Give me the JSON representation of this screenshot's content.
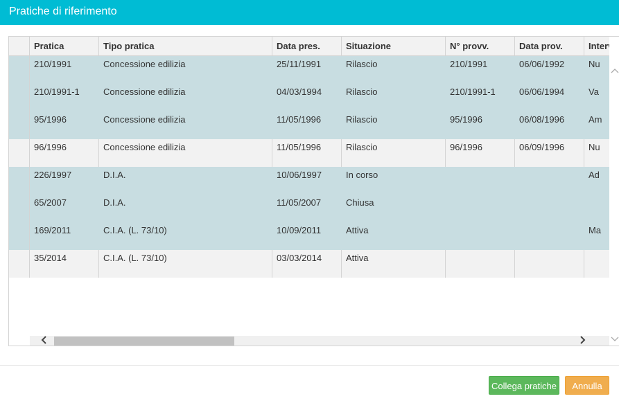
{
  "dialog": {
    "title": "Pratiche di riferimento"
  },
  "table": {
    "columns": [
      "Pratica",
      "Tipo pratica",
      "Data pres.",
      "Situazione",
      "N° provv.",
      "Data prov.",
      "Interv"
    ],
    "rows": [
      {
        "cells": [
          "210/1991",
          "Concessione edilizia",
          "25/11/1991",
          "Rilascio",
          "210/1991",
          "06/06/1992",
          "Nu"
        ],
        "selected": true
      },
      {
        "cells": [
          "210/1991-1",
          "Concessione edilizia",
          "04/03/1994",
          "Rilascio",
          "210/1991-1",
          "06/06/1994",
          "Va"
        ],
        "selected": true
      },
      {
        "cells": [
          "95/1996",
          "Concessione edilizia",
          "11/05/1996",
          "Rilascio",
          "95/1996",
          "06/08/1996",
          "Am"
        ],
        "selected": true
      },
      {
        "cells": [
          "96/1996",
          "Concessione edilizia",
          "11/05/1996",
          "Rilascio",
          "96/1996",
          "06/09/1996",
          "Nu"
        ],
        "selected": false
      },
      {
        "cells": [
          "226/1997",
          "D.I.A.",
          "10/06/1997",
          "In corso",
          "",
          "",
          "Ad"
        ],
        "selected": true
      },
      {
        "cells": [
          "65/2007",
          "D.I.A.",
          "11/05/2007",
          "Chiusa",
          "",
          "",
          ""
        ],
        "selected": true
      },
      {
        "cells": [
          "169/2011",
          "C.I.A. (L. 73/10)",
          "10/09/2011",
          "Attiva",
          "",
          "",
          "Ma"
        ],
        "selected": true
      },
      {
        "cells": [
          "35/2014",
          "C.I.A. (L. 73/10)",
          "03/03/2014",
          "Attiva",
          "",
          "",
          ""
        ],
        "selected": false
      }
    ]
  },
  "icons": {
    "scroll_up": "chevron-up-icon",
    "scroll_down": "chevron-down-icon",
    "scroll_left": "chevron-left-icon",
    "scroll_right": "chevron-right-icon"
  },
  "buttons": {
    "link_label": "Collega pratiche",
    "cancel_label": "Annulla"
  },
  "colors": {
    "title_bar": "#00bcd4",
    "row_selected": "#c8dde1",
    "row_plain": "#f2f2f2",
    "link_button": "#5cb85c",
    "cancel_button": "#f0ad4e"
  }
}
